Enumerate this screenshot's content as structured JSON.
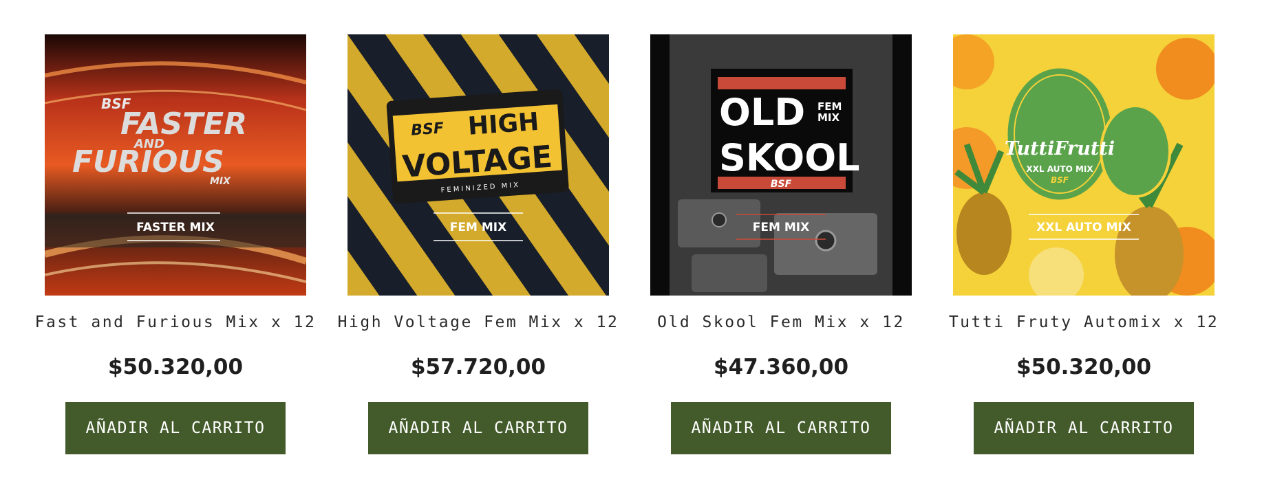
{
  "products": [
    {
      "name": "Fast and Furious Mix x 12",
      "price": "$50.320,00",
      "button_label": "AÑADIR AL CARRITO",
      "art": {
        "brand": "BSF",
        "line1": "FASTER",
        "line2": "AND",
        "line3": "FURIOUS",
        "line4": "MIX",
        "tag": "FASTER MIX"
      }
    },
    {
      "name": "High Voltage Fem Mix x 12",
      "price": "$57.720,00",
      "button_label": "AÑADIR AL CARRITO",
      "art": {
        "brand": "BSF",
        "line1": "HIGH",
        "line2": "VOLTAGE",
        "sub": "FEMINIZED MIX",
        "tag": "FEM MIX"
      }
    },
    {
      "name": "Old Skool Fem Mix x 12",
      "price": "$47.360,00",
      "button_label": "AÑADIR AL CARRITO",
      "art": {
        "line1": "OLD",
        "line2": "SKOOL",
        "corner1": "FEM",
        "corner2": "MIX",
        "brand": "BSF",
        "tag": "FEM MIX"
      }
    },
    {
      "name": "Tutti Fruty Automix x 12",
      "price": "$50.320,00",
      "button_label": "AÑADIR AL CARRITO",
      "art": {
        "logo": "TuttiFrutti",
        "sub": "XXL AUTO MIX",
        "brand": "BSF",
        "tag": "XXL AUTO MIX"
      }
    }
  ],
  "colors": {
    "button_bg": "#435b2b",
    "button_text": "#ffffff",
    "price": "#1f1f1f"
  }
}
